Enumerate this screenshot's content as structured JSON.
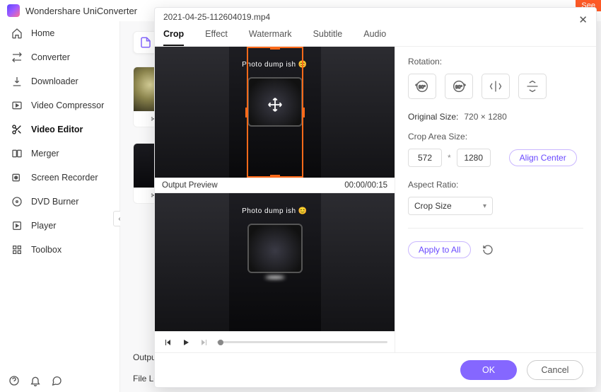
{
  "app": {
    "title": "Wondershare UniConverter",
    "ribbon": "See"
  },
  "sidebar": {
    "items": [
      {
        "label": "Home"
      },
      {
        "label": "Converter"
      },
      {
        "label": "Downloader"
      },
      {
        "label": "Video Compressor"
      },
      {
        "label": "Video Editor"
      },
      {
        "label": "Merger"
      },
      {
        "label": "Screen Recorder"
      },
      {
        "label": "DVD Burner"
      },
      {
        "label": "Player"
      },
      {
        "label": "Toolbox"
      }
    ]
  },
  "main": {
    "output_label": "Output F",
    "file_loc_label": "File Loca"
  },
  "modal": {
    "filename": "2021-04-25-112604019.mp4",
    "tabs": [
      "Crop",
      "Effect",
      "Watermark",
      "Subtitle",
      "Audio"
    ],
    "preview": {
      "caption": "Photo dump ish",
      "output_label": "Output Preview",
      "time": "00:00/00:15"
    },
    "settings": {
      "rotation_label": "Rotation:",
      "original_size_label": "Original Size:",
      "original_size_value": "720 × 1280",
      "crop_area_label": "Crop Area Size:",
      "crop_w": "572",
      "crop_h": "1280",
      "align_center": "Align Center",
      "aspect_label": "Aspect Ratio:",
      "aspect_value": "Crop Size",
      "apply_all": "Apply to All"
    },
    "buttons": {
      "ok": "OK",
      "cancel": "Cancel"
    }
  }
}
